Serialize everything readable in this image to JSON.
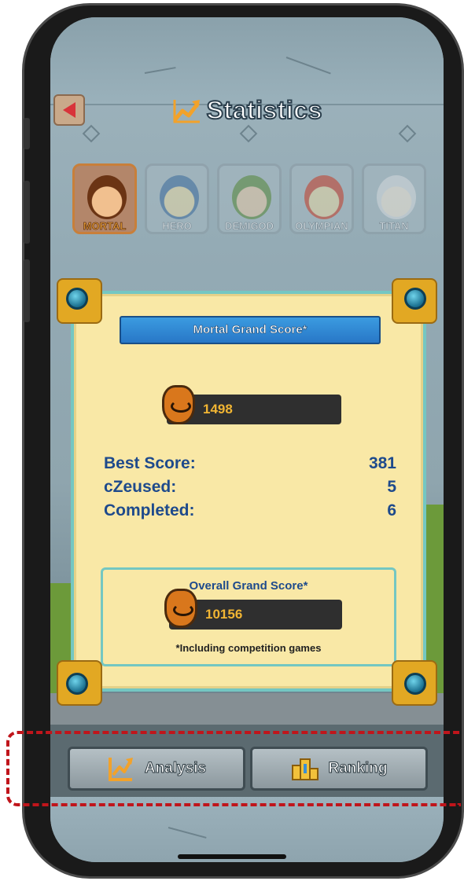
{
  "header": {
    "title": "Statistics",
    "back_icon": "back-triangle-icon",
    "title_icon": "trend-arrow-icon"
  },
  "levels": [
    {
      "label": "MORTAL",
      "state": "selected"
    },
    {
      "label": "HERO",
      "state": "locked"
    },
    {
      "label": "DEMIGOD",
      "state": "locked"
    },
    {
      "label": "OLYMPIAN",
      "state": "locked"
    },
    {
      "label": "TITAN",
      "state": "locked"
    }
  ],
  "panel": {
    "header": "Mortal Grand Score*",
    "grand_score": "1498",
    "stats": [
      {
        "label": "Best Score:",
        "value": "381"
      },
      {
        "label": "cZeused:",
        "value": "5"
      },
      {
        "label": "Completed:",
        "value": "6"
      }
    ],
    "overall": {
      "title": "Overall Grand Score*",
      "score": "10156",
      "note": "*Including competition games"
    }
  },
  "buttons": {
    "analysis": "Analysis",
    "ranking": "Ranking"
  },
  "colors": {
    "accent_blue": "#2877c7",
    "stat_text": "#1e4a8c",
    "score_gold": "#f1b533",
    "panel_bg": "#f9e8a6",
    "highlight": "#c0151b"
  }
}
